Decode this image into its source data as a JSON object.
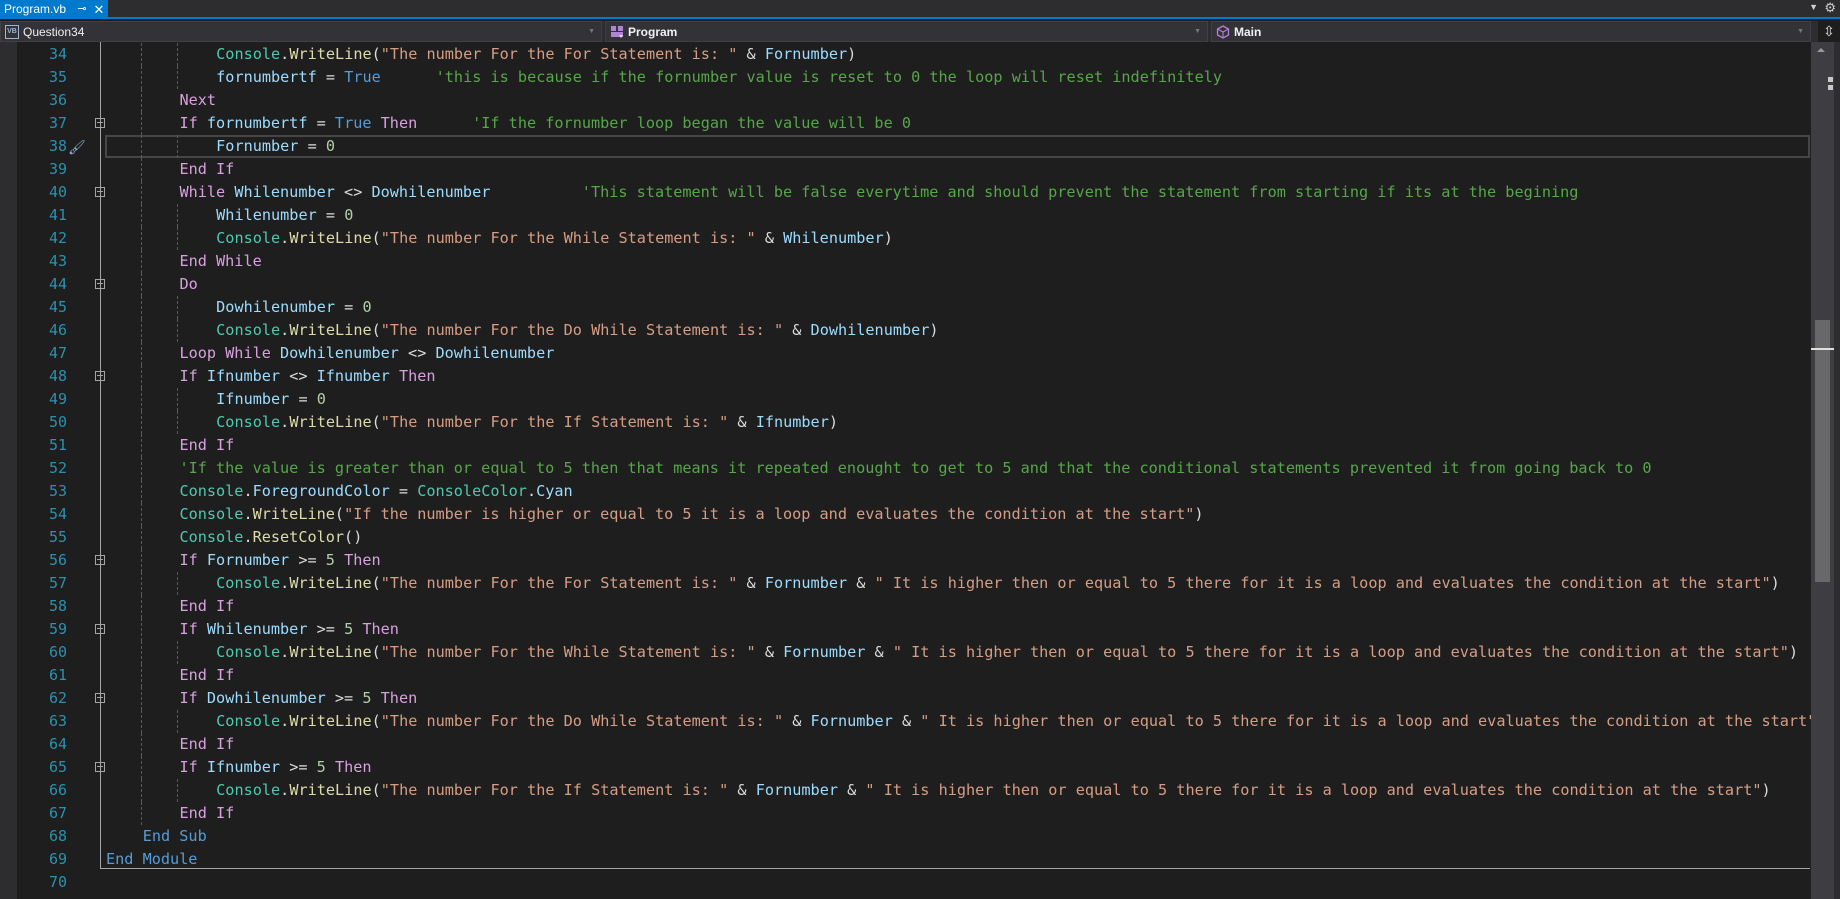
{
  "tab": {
    "title": "Program.vb",
    "pin_icon": "⊸",
    "close_icon": "✕"
  },
  "tabstrip": {
    "overflow_icon": "▼",
    "settings_icon": "⚙"
  },
  "navbar": {
    "project": {
      "label": "Question34",
      "icon": "VB"
    },
    "type": {
      "label": "Program"
    },
    "member": {
      "label": "Main"
    },
    "split_icon": "⇳"
  },
  "editor": {
    "current_line": 38,
    "lines": [
      {
        "n": "34",
        "tokens": [
          [
            "typ",
            "Console"
          ],
          [
            "pl",
            "."
          ],
          [
            "fn",
            "WriteLine"
          ],
          [
            "pl",
            "("
          ],
          [
            "str",
            "\"The number For the For Statement is: \""
          ],
          [
            "pl",
            " & "
          ],
          [
            "var",
            "Fornumber"
          ],
          [
            "pl",
            ")"
          ]
        ]
      },
      {
        "n": "35",
        "tokens": [
          [
            "var",
            "fornumbertf"
          ],
          [
            "pl",
            " = "
          ],
          [
            "kw",
            "True"
          ],
          [
            "pl",
            "      "
          ],
          [
            "cmt",
            "'this is because if the fornumber value is reset to 0 the loop will reset indefinitely"
          ]
        ]
      },
      {
        "n": "36",
        "tokens": [
          [
            "ctl",
            "Next"
          ]
        ]
      },
      {
        "n": "37",
        "tokens": [
          [
            "ctl",
            "If"
          ],
          [
            "pl",
            " "
          ],
          [
            "var",
            "fornumbertf"
          ],
          [
            "pl",
            " = "
          ],
          [
            "kw",
            "True"
          ],
          [
            "pl",
            " "
          ],
          [
            "ctl",
            "Then"
          ],
          [
            "pl",
            "      "
          ],
          [
            "cmt",
            "'If the fornumber loop began the value will be 0"
          ]
        ]
      },
      {
        "n": "38",
        "tokens": [
          [
            "var",
            "Fornumber"
          ],
          [
            "pl",
            " = "
          ],
          [
            "num",
            "0"
          ]
        ]
      },
      {
        "n": "39",
        "tokens": [
          [
            "ctl",
            "End If"
          ]
        ]
      },
      {
        "n": "40",
        "tokens": [
          [
            "ctl",
            "While"
          ],
          [
            "pl",
            " "
          ],
          [
            "var",
            "Whilenumber"
          ],
          [
            "pl",
            " <> "
          ],
          [
            "var",
            "Dowhilenumber"
          ],
          [
            "pl",
            "          "
          ],
          [
            "cmt",
            "'This statement will be false everytime and should prevent the statement from starting if its at the begining"
          ]
        ]
      },
      {
        "n": "41",
        "tokens": [
          [
            "var",
            "Whilenumber"
          ],
          [
            "pl",
            " = "
          ],
          [
            "num",
            "0"
          ]
        ]
      },
      {
        "n": "42",
        "tokens": [
          [
            "typ",
            "Console"
          ],
          [
            "pl",
            "."
          ],
          [
            "fn",
            "WriteLine"
          ],
          [
            "pl",
            "("
          ],
          [
            "str",
            "\"The number For the While Statement is: \""
          ],
          [
            "pl",
            " & "
          ],
          [
            "var",
            "Whilenumber"
          ],
          [
            "pl",
            ")"
          ]
        ]
      },
      {
        "n": "43",
        "tokens": [
          [
            "ctl",
            "End While"
          ]
        ]
      },
      {
        "n": "44",
        "tokens": [
          [
            "ctl",
            "Do"
          ]
        ]
      },
      {
        "n": "45",
        "tokens": [
          [
            "var",
            "Dowhilenumber"
          ],
          [
            "pl",
            " = "
          ],
          [
            "num",
            "0"
          ]
        ]
      },
      {
        "n": "46",
        "tokens": [
          [
            "typ",
            "Console"
          ],
          [
            "pl",
            "."
          ],
          [
            "fn",
            "WriteLine"
          ],
          [
            "pl",
            "("
          ],
          [
            "str",
            "\"The number For the Do While Statement is: \""
          ],
          [
            "pl",
            " & "
          ],
          [
            "var",
            "Dowhilenumber"
          ],
          [
            "pl",
            ")"
          ]
        ]
      },
      {
        "n": "47",
        "tokens": [
          [
            "ctl",
            "Loop While"
          ],
          [
            "pl",
            " "
          ],
          [
            "var",
            "Dowhilenumber"
          ],
          [
            "pl",
            " <> "
          ],
          [
            "var",
            "Dowhilenumber"
          ]
        ]
      },
      {
        "n": "48",
        "tokens": [
          [
            "ctl",
            "If"
          ],
          [
            "pl",
            " "
          ],
          [
            "var",
            "Ifnumber"
          ],
          [
            "pl",
            " <> "
          ],
          [
            "var",
            "Ifnumber"
          ],
          [
            "pl",
            " "
          ],
          [
            "ctl",
            "Then"
          ]
        ]
      },
      {
        "n": "49",
        "tokens": [
          [
            "var",
            "Ifnumber"
          ],
          [
            "pl",
            " = "
          ],
          [
            "num",
            "0"
          ]
        ]
      },
      {
        "n": "50",
        "tokens": [
          [
            "typ",
            "Console"
          ],
          [
            "pl",
            "."
          ],
          [
            "fn",
            "WriteLine"
          ],
          [
            "pl",
            "("
          ],
          [
            "str",
            "\"The number For the If Statement is: \""
          ],
          [
            "pl",
            " & "
          ],
          [
            "var",
            "Ifnumber"
          ],
          [
            "pl",
            ")"
          ]
        ]
      },
      {
        "n": "51",
        "tokens": [
          [
            "ctl",
            "End If"
          ]
        ]
      },
      {
        "n": "52",
        "tokens": [
          [
            "cmt",
            "'If the value is greater than or equal to 5 then that means it repeated enought to get to 5 and that the conditional statements prevented it from going back to 0"
          ]
        ]
      },
      {
        "n": "53",
        "tokens": [
          [
            "typ",
            "Console"
          ],
          [
            "pl",
            "."
          ],
          [
            "var",
            "ForegroundColor"
          ],
          [
            "pl",
            " = "
          ],
          [
            "typ",
            "ConsoleColor"
          ],
          [
            "pl",
            "."
          ],
          [
            "var",
            "Cyan"
          ]
        ]
      },
      {
        "n": "54",
        "tokens": [
          [
            "typ",
            "Console"
          ],
          [
            "pl",
            "."
          ],
          [
            "fn",
            "WriteLine"
          ],
          [
            "pl",
            "("
          ],
          [
            "str",
            "\"If the number is higher or equal to 5 it is a loop and evaluates the condition at the start\""
          ],
          [
            "pl",
            ")"
          ]
        ]
      },
      {
        "n": "55",
        "tokens": [
          [
            "typ",
            "Console"
          ],
          [
            "pl",
            "."
          ],
          [
            "fn",
            "ResetColor"
          ],
          [
            "pl",
            "()"
          ]
        ]
      },
      {
        "n": "56",
        "tokens": [
          [
            "ctl",
            "If"
          ],
          [
            "pl",
            " "
          ],
          [
            "var",
            "Fornumber"
          ],
          [
            "pl",
            " >= "
          ],
          [
            "num",
            "5"
          ],
          [
            "pl",
            " "
          ],
          [
            "ctl",
            "Then"
          ]
        ]
      },
      {
        "n": "57",
        "tokens": [
          [
            "typ",
            "Console"
          ],
          [
            "pl",
            "."
          ],
          [
            "fn",
            "WriteLine"
          ],
          [
            "pl",
            "("
          ],
          [
            "str",
            "\"The number For the For Statement is: \""
          ],
          [
            "pl",
            " & "
          ],
          [
            "var",
            "Fornumber"
          ],
          [
            "pl",
            " & "
          ],
          [
            "str",
            "\" It is higher then or equal to 5 there for it is a loop and evaluates the condition at the start\""
          ],
          [
            "pl",
            ")"
          ]
        ]
      },
      {
        "n": "58",
        "tokens": [
          [
            "ctl",
            "End If"
          ]
        ]
      },
      {
        "n": "59",
        "tokens": [
          [
            "ctl",
            "If"
          ],
          [
            "pl",
            " "
          ],
          [
            "var",
            "Whilenumber"
          ],
          [
            "pl",
            " >= "
          ],
          [
            "num",
            "5"
          ],
          [
            "pl",
            " "
          ],
          [
            "ctl",
            "Then"
          ]
        ]
      },
      {
        "n": "60",
        "tokens": [
          [
            "typ",
            "Console"
          ],
          [
            "pl",
            "."
          ],
          [
            "fn",
            "WriteLine"
          ],
          [
            "pl",
            "("
          ],
          [
            "str",
            "\"The number For the While Statement is: \""
          ],
          [
            "pl",
            " & "
          ],
          [
            "var",
            "Fornumber"
          ],
          [
            "pl",
            " & "
          ],
          [
            "str",
            "\" It is higher then or equal to 5 there for it is a loop and evaluates the condition at the start\""
          ],
          [
            "pl",
            ")"
          ]
        ]
      },
      {
        "n": "61",
        "tokens": [
          [
            "ctl",
            "End If"
          ]
        ]
      },
      {
        "n": "62",
        "tokens": [
          [
            "ctl",
            "If"
          ],
          [
            "pl",
            " "
          ],
          [
            "var",
            "Dowhilenumber"
          ],
          [
            "pl",
            " >= "
          ],
          [
            "num",
            "5"
          ],
          [
            "pl",
            " "
          ],
          [
            "ctl",
            "Then"
          ]
        ]
      },
      {
        "n": "63",
        "tokens": [
          [
            "typ",
            "Console"
          ],
          [
            "pl",
            "."
          ],
          [
            "fn",
            "WriteLine"
          ],
          [
            "pl",
            "("
          ],
          [
            "str",
            "\"The number For the Do While Statement is: \""
          ],
          [
            "pl",
            " & "
          ],
          [
            "var",
            "Fornumber"
          ],
          [
            "pl",
            " & "
          ],
          [
            "str",
            "\" It is higher then or equal to 5 there for it is a loop and evaluates the condition at the start\""
          ],
          [
            "pl",
            ")"
          ]
        ]
      },
      {
        "n": "64",
        "tokens": [
          [
            "ctl",
            "End If"
          ]
        ]
      },
      {
        "n": "65",
        "tokens": [
          [
            "ctl",
            "If"
          ],
          [
            "pl",
            " "
          ],
          [
            "var",
            "Ifnumber"
          ],
          [
            "pl",
            " >= "
          ],
          [
            "num",
            "5"
          ],
          [
            "pl",
            " "
          ],
          [
            "ctl",
            "Then"
          ]
        ]
      },
      {
        "n": "66",
        "tokens": [
          [
            "typ",
            "Console"
          ],
          [
            "pl",
            "."
          ],
          [
            "fn",
            "WriteLine"
          ],
          [
            "pl",
            "("
          ],
          [
            "str",
            "\"The number For the If Statement is: \""
          ],
          [
            "pl",
            " & "
          ],
          [
            "var",
            "Fornumber"
          ],
          [
            "pl",
            " & "
          ],
          [
            "str",
            "\" It is higher then or equal to 5 there for it is a loop and evaluates the condition at the start\""
          ],
          [
            "pl",
            ")"
          ]
        ]
      },
      {
        "n": "67",
        "tokens": [
          [
            "ctl",
            "End If"
          ]
        ]
      },
      {
        "n": "68",
        "tokens": [
          [
            "kw",
            "End Sub"
          ]
        ]
      },
      {
        "n": "69",
        "tokens": [
          [
            "kw",
            "End Module"
          ]
        ]
      },
      {
        "n": "70",
        "tokens": []
      }
    ]
  },
  "scrollbar": {
    "position_fraction": 0.36
  }
}
